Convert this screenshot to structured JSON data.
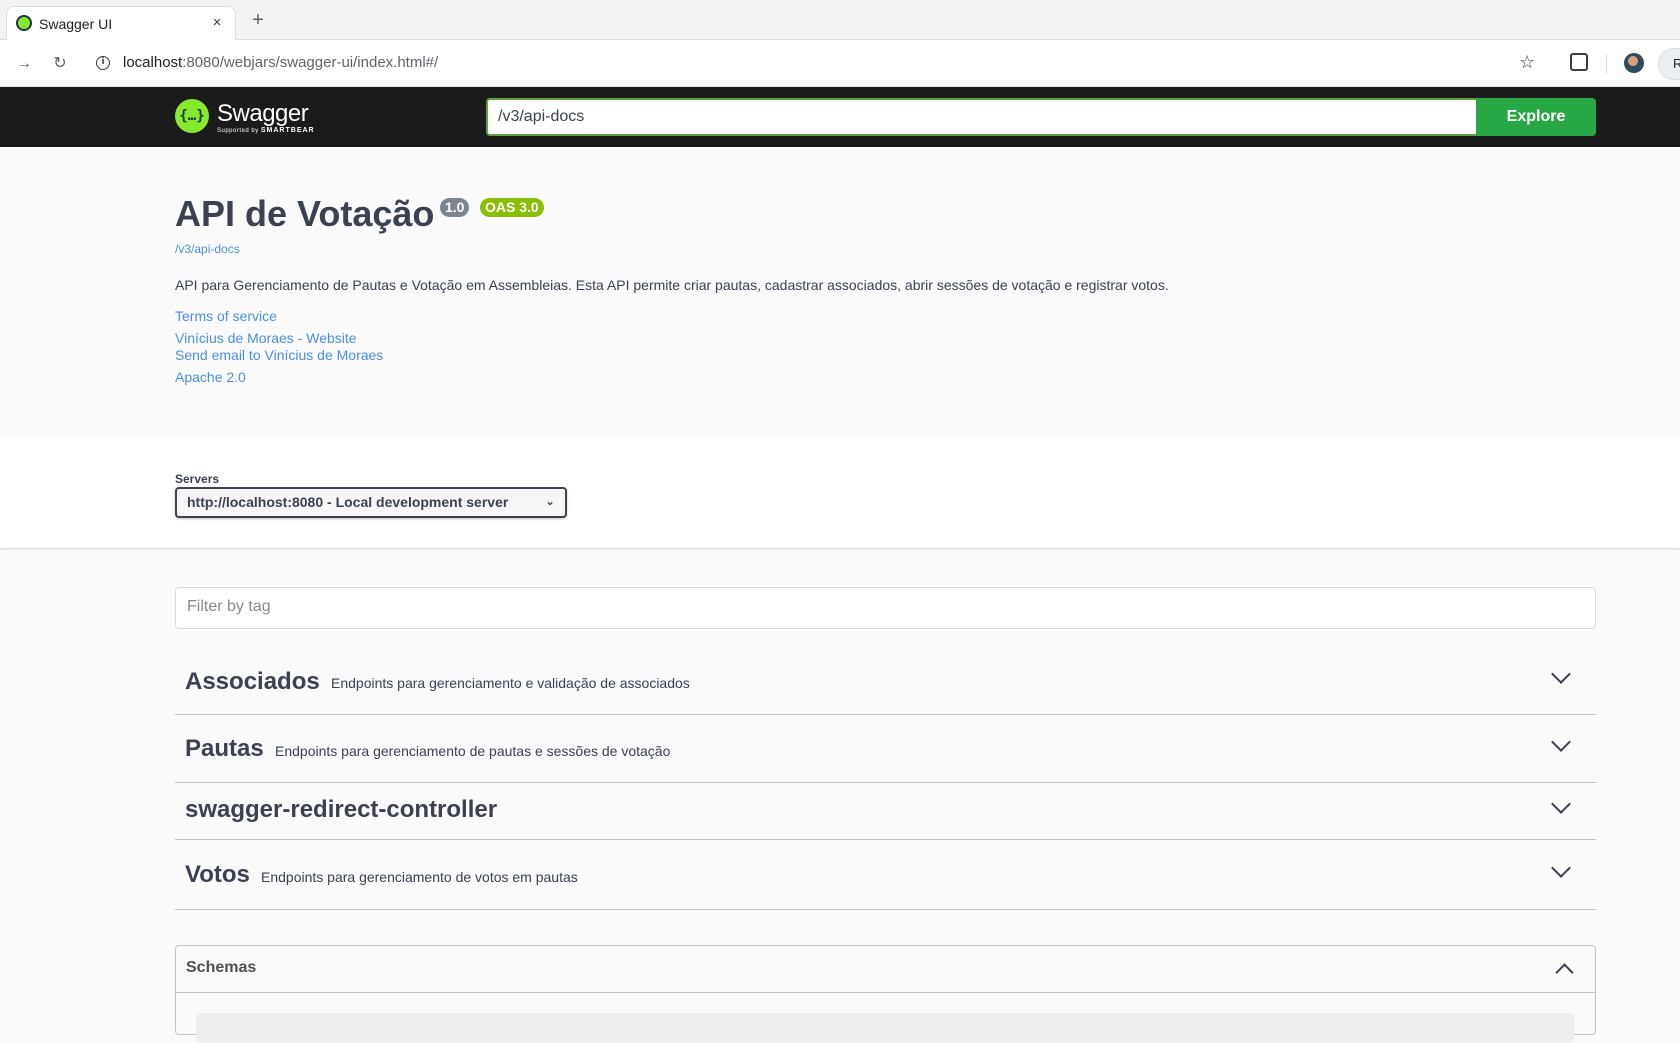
{
  "browser": {
    "tab_title": "Swagger UI",
    "tab_close": "×",
    "new_tab": "+",
    "url_host": "localhost",
    "url_rest": ":8080/webjars/swagger-ui/index.html#/",
    "back_icon": "→",
    "reload_icon": "↻",
    "star_icon": "☆",
    "profile_chip": "R"
  },
  "topbar": {
    "logo_text": "Swagger",
    "logo_sub": "Supported by",
    "logo_sub_brand": "SMARTBEAR",
    "logo_mark": "{…}",
    "spec_url": "/v3/api-docs",
    "explore_label": "Explore",
    "accent": "#85ea2d",
    "button_color": "#28a745"
  },
  "info": {
    "title": "API de Votação",
    "version": "1.0",
    "oas": "OAS 3.0",
    "spec_link": "/v3/api-docs",
    "description": "API para Gerenciamento de Pautas e Votação em Assembleias. Esta API permite criar pautas, cadastrar associados, abrir sessões de votação e registrar votos.",
    "terms": "Terms of service",
    "contact_website": "Vinícius de Moraes - Website",
    "contact_email": "Send email to Vinícius de Moraes",
    "license": "Apache 2.0"
  },
  "servers": {
    "label": "Servers",
    "selected": "http://localhost:8080 - Local development server"
  },
  "filter": {
    "placeholder": "Filter by tag"
  },
  "tags": [
    {
      "name": "Associados",
      "description": "Endpoints para gerenciamento e validação de associados"
    },
    {
      "name": "Pautas",
      "description": "Endpoints para gerenciamento de pautas e sessões de votação"
    },
    {
      "name": "swagger-redirect-controller",
      "description": ""
    },
    {
      "name": "Votos",
      "description": "Endpoints para gerenciamento de votos em pautas"
    }
  ],
  "schemas": {
    "title": "Schemas"
  }
}
